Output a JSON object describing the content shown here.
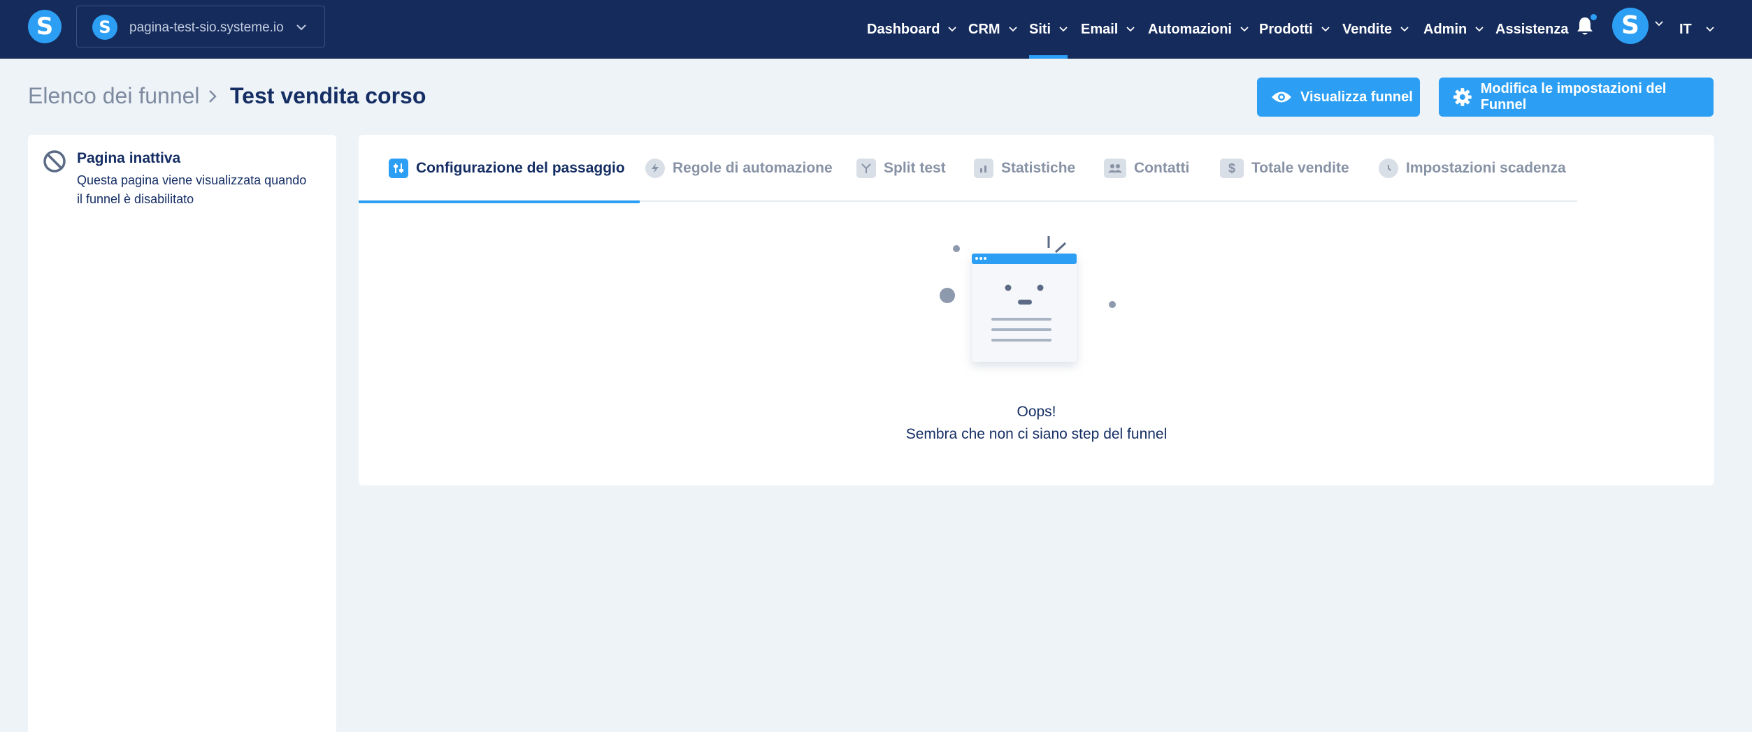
{
  "topbar": {
    "logo_letter": "S",
    "site_selector": {
      "logo_letter": "S",
      "label": "pagina-test-sio.systeme.io"
    },
    "nav": [
      {
        "label": "Dashboard"
      },
      {
        "label": "CRM"
      },
      {
        "label": "Siti",
        "active": true
      },
      {
        "label": "Email"
      },
      {
        "label": "Automazioni"
      },
      {
        "label": "Prodotti"
      },
      {
        "label": "Vendite"
      },
      {
        "label": "Admin"
      },
      {
        "label": "Assistenza"
      }
    ],
    "avatar_letter": "S",
    "language": "IT"
  },
  "header": {
    "breadcrumb_root": "Elenco dei funnel",
    "breadcrumb_current": "Test vendita corso",
    "view_button": "Visualizza funnel",
    "settings_button": "Modifica le impostazioni del Funnel"
  },
  "left_panel": {
    "title": "Pagina inattiva",
    "description": "Questa pagina viene visualizzata quando il funnel è disabilitato"
  },
  "tabs": [
    {
      "label": "Configurazione del passaggio",
      "icon": "sliders-icon",
      "active": true
    },
    {
      "label": "Regole di automazione",
      "icon": "lightning-icon"
    },
    {
      "label": "Split test",
      "icon": "split-icon"
    },
    {
      "label": "Statistiche",
      "icon": "bar-chart-icon"
    },
    {
      "label": "Contatti",
      "icon": "users-icon"
    },
    {
      "label": "Totale vendite",
      "icon": "dollar-icon"
    },
    {
      "label": "Impostazioni scadenza",
      "icon": "clock-icon"
    }
  ],
  "empty_state": {
    "title": "Oops!",
    "message": "Sembra che non ci siano step del funnel"
  },
  "colors": {
    "topbar": "#152b5c",
    "accent": "#2c9ff4",
    "background": "#eef3f8",
    "text": "#142d63"
  }
}
